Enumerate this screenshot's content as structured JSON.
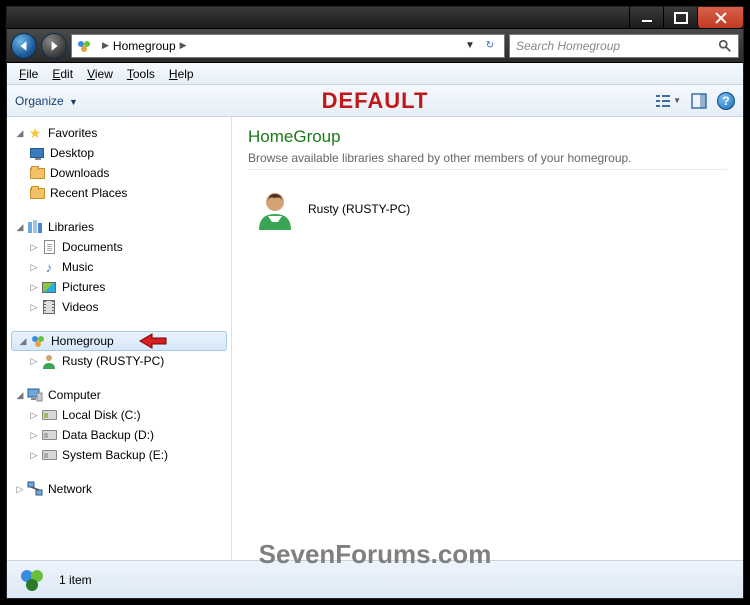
{
  "titlebar": {
    "min": "min",
    "max": "max",
    "close": "close"
  },
  "nav": {
    "crumb": "Homegroup",
    "search_placeholder": "Search Homegroup"
  },
  "menu": {
    "file": "File",
    "edit": "Edit",
    "view": "View",
    "tools": "Tools",
    "help": "Help"
  },
  "toolbar": {
    "organize": "Organize",
    "overlay": "DEFAULT"
  },
  "sidebar": {
    "favorites": {
      "label": "Favorites",
      "items": [
        {
          "label": "Desktop"
        },
        {
          "label": "Downloads"
        },
        {
          "label": "Recent Places"
        }
      ]
    },
    "libraries": {
      "label": "Libraries",
      "items": [
        {
          "label": "Documents"
        },
        {
          "label": "Music"
        },
        {
          "label": "Pictures"
        },
        {
          "label": "Videos"
        }
      ]
    },
    "homegroup": {
      "label": "Homegroup",
      "items": [
        {
          "label": "Rusty (RUSTY-PC)"
        }
      ]
    },
    "computer": {
      "label": "Computer",
      "items": [
        {
          "label": "Local Disk (C:)"
        },
        {
          "label": "Data Backup (D:)"
        },
        {
          "label": "System Backup (E:)"
        }
      ]
    },
    "network": {
      "label": "Network"
    }
  },
  "content": {
    "heading": "HomeGroup",
    "desc": "Browse available libraries shared by other members of your homegroup.",
    "entry": "Rusty (RUSTY-PC)"
  },
  "status": {
    "count": "1 item"
  },
  "watermark": "SevenForums.com"
}
